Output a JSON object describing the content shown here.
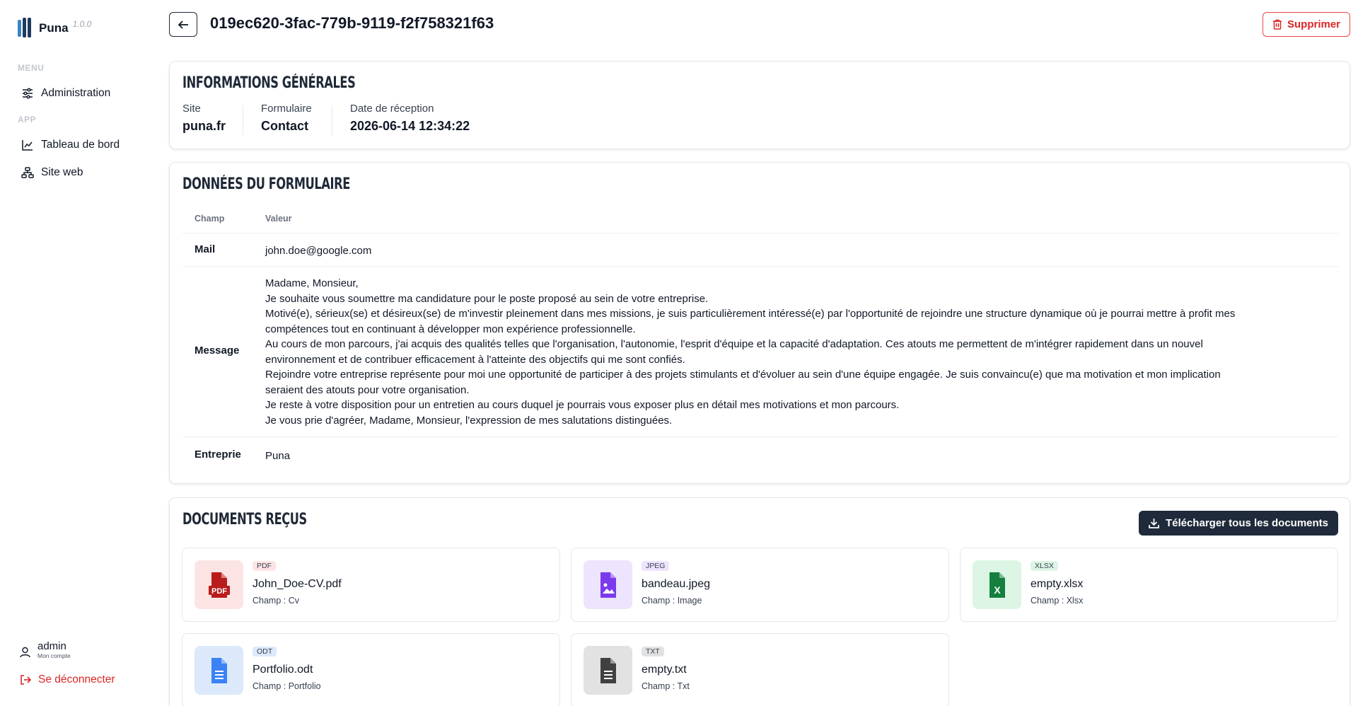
{
  "app": {
    "name": "Puna",
    "version": "1.0.0"
  },
  "sidebar": {
    "sections": [
      {
        "title": "MENU",
        "items": [
          {
            "label": "Administration",
            "icon": "sliders-icon"
          }
        ]
      },
      {
        "title": "APP",
        "items": [
          {
            "label": "Tableau de bord",
            "icon": "chart-line-icon"
          },
          {
            "label": "Site web",
            "icon": "sitemap-icon"
          }
        ]
      }
    ],
    "user": {
      "name": "admin",
      "subtitle": "Mon compte"
    },
    "logout_label": "Se déconnecter"
  },
  "header": {
    "title": "019ec620-3fac-779b-9119-f2f758321f63",
    "delete_label": "Supprimer"
  },
  "general": {
    "title": "Informations générales",
    "fields": [
      {
        "label": "Site",
        "value": "puna.fr"
      },
      {
        "label": "Formulaire",
        "value": "Contact"
      },
      {
        "label": "Date de réception",
        "value": "2026-06-14 12:34:22"
      }
    ]
  },
  "form_data": {
    "title": "Données du formulaire",
    "columns": [
      "Champ",
      "Valeur"
    ],
    "rows": [
      {
        "field": "Mail",
        "value": [
          "john.doe@google.com"
        ]
      },
      {
        "field": "Message",
        "value": [
          "Madame, Monsieur,",
          "Je souhaite vous soumettre ma candidature pour le poste proposé au sein de votre entreprise.",
          "Motivé(e), sérieux(se) et désireux(se) de m'investir pleinement dans mes missions, je suis particulièrement intéressé(e) par l'opportunité de rejoindre une structure dynamique où je pourrai mettre à profit mes",
          "compétences tout en continuant à développer mon expérience professionnelle.",
          "Au cours de mon parcours, j'ai acquis des qualités telles que l'organisation, l'autonomie, l'esprit d'équipe et la capacité d'adaptation. Ces atouts me permettent de m'intégrer rapidement dans un nouvel",
          "environnement et de contribuer efficacement à l'atteinte des objectifs qui me sont confiés.",
          "Rejoindre votre entreprise représente pour moi une opportunité de participer à des projets stimulants et d'évoluer au sein d'une équipe engagée. Je suis convaincu(e) que ma motivation et mon implication",
          "seraient des atouts pour votre organisation.",
          "Je reste à votre disposition pour un entretien au cours duquel je pourrais vous exposer plus en détail mes motivations et mon parcours.",
          "Je vous prie d'agréer, Madame, Monsieur, l'expression de mes salutations distinguées."
        ]
      },
      {
        "field": "Entreprie",
        "value": [
          "Puna"
        ]
      }
    ]
  },
  "documents": {
    "title": "Documents reçus",
    "download_all_label": "Télécharger tous les documents",
    "items": [
      {
        "type": "PDF",
        "name": "John_Doe-CV.pdf",
        "field": "Champ : Cv",
        "icon": "file-pdf-icon",
        "color": "#b91c1c",
        "bg": "#fde4e4",
        "badge_bg": "#fde4e4"
      },
      {
        "type": "JPEG",
        "name": "bandeau.jpeg",
        "field": "Champ : Image",
        "icon": "file-image-icon",
        "color": "#7c3aed",
        "bg": "#ede4fd",
        "badge_bg": "#ede4fd"
      },
      {
        "type": "XLSX",
        "name": "empty.xlsx",
        "field": "Champ : Xlsx",
        "icon": "file-excel-icon",
        "color": "#15803d",
        "bg": "#dcf5e4",
        "badge_bg": "#dcf5e4"
      },
      {
        "type": "ODT",
        "name": "Portfolio.odt",
        "field": "Champ : Portfolio",
        "icon": "file-document-icon",
        "color": "#3b82f6",
        "bg": "#dbe9fb",
        "badge_bg": "#dbe9fb"
      },
      {
        "type": "TXT",
        "name": "empty.txt",
        "field": "Champ : Txt",
        "icon": "file-text-icon",
        "color": "#404040",
        "bg": "#e2e2e2",
        "badge_bg": "#e2e2e2"
      }
    ]
  }
}
